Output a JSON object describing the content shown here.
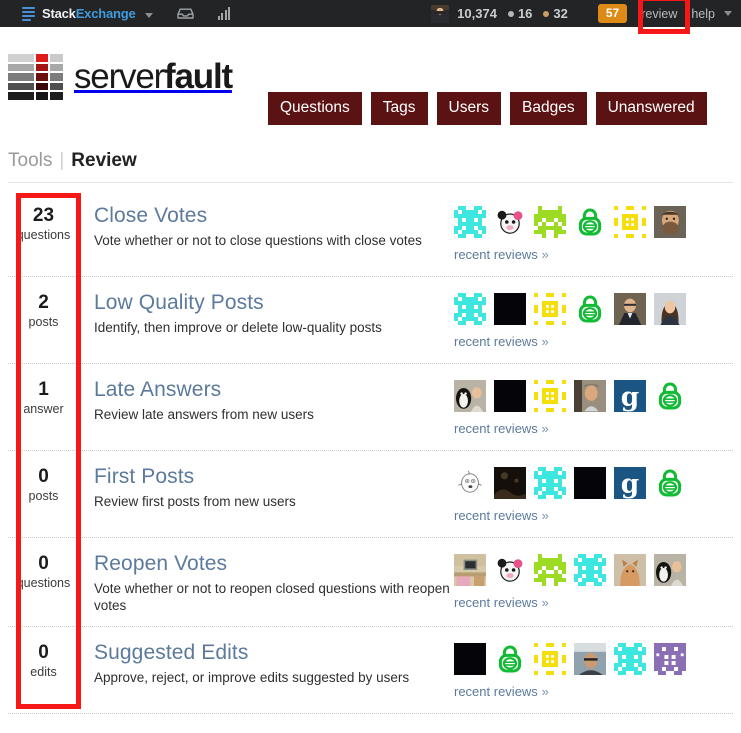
{
  "topbar": {
    "network_name_white": "Stack",
    "network_name_blue": "Exchange",
    "network_icon": "stacked-layers-icon",
    "inbox_icon": "inbox-icon",
    "achievements_icon": "achievements-bar-chart-icon",
    "reputation": "10,374",
    "silver_badges": "16",
    "bronze_badges": "32",
    "review_count_badge": "57",
    "review_link": "review",
    "help_link": "help",
    "badge_color": "#dd8a17",
    "silver_color": "#b4b8bc",
    "bronze_color": "#ca9a69",
    "bar_color": "#222426"
  },
  "site": {
    "logo_word_light": "server",
    "logo_word_bold": "fault",
    "nav": [
      {
        "label": "Questions"
      },
      {
        "label": "Tags"
      },
      {
        "label": "Users"
      },
      {
        "label": "Badges"
      },
      {
        "label": "Unanswered"
      }
    ],
    "nav_color": "#5b1212"
  },
  "breadcrumb": {
    "parent": "Tools",
    "separator": "|",
    "current": "Review"
  },
  "reviews": {
    "recent_reviews_label": "recent reviews",
    "recent_reviews_arrow": "»",
    "rows": [
      {
        "count": "23",
        "unit": "questions",
        "title": "Close Votes",
        "desc": "Vote whether or not to close questions with close votes",
        "avatars": [
          "identicon-cyan",
          "photo-cow-cartoon",
          "identicon-green",
          "identicon-green-lock",
          "identicon-yellow",
          "photo-man-beard"
        ]
      },
      {
        "count": "2",
        "unit": "posts",
        "title": "Low Quality Posts",
        "desc": "Identify, then improve or delete low-quality posts",
        "avatars": [
          "identicon-cyan",
          "avatar-black",
          "identicon-yellow",
          "identicon-green-lock",
          "photo-man-suit",
          "photo-woman"
        ]
      },
      {
        "count": "1",
        "unit": "answer",
        "title": "Late Answers",
        "desc": "Review late answers from new users",
        "avatars": [
          "photo-penguin-man",
          "avatar-black",
          "identicon-yellow",
          "photo-man-glasses",
          "gravatar-g-logo",
          "identicon-green-lock"
        ]
      },
      {
        "count": "0",
        "unit": "posts",
        "title": "First Posts",
        "desc": "Review first posts from new users",
        "avatars": [
          "monster-white",
          "photo-dark",
          "identicon-cyan",
          "avatar-black",
          "gravatar-g-logo",
          "identicon-green-lock"
        ]
      },
      {
        "count": "0",
        "unit": "questions",
        "title": "Reopen Votes",
        "desc": "Vote whether or not to reopen closed questions with reopen votes",
        "avatars": [
          "photo-computer-desk",
          "photo-cow-cartoon",
          "identicon-green",
          "identicon-cyan",
          "photo-cat",
          "photo-penguin-man"
        ]
      },
      {
        "count": "0",
        "unit": "edits",
        "title": "Suggested Edits",
        "desc": "Approve, reject, or improve edits suggested by users",
        "avatars": [
          "avatar-black",
          "identicon-green-lock",
          "identicon-yellow",
          "photo-man-car",
          "identicon-cyan",
          "identicon-purple"
        ]
      }
    ]
  },
  "annotations": {
    "highlight_color": "#f61717",
    "boxes": [
      {
        "name": "review-count-highlight"
      },
      {
        "name": "counts-column-highlight"
      }
    ]
  }
}
